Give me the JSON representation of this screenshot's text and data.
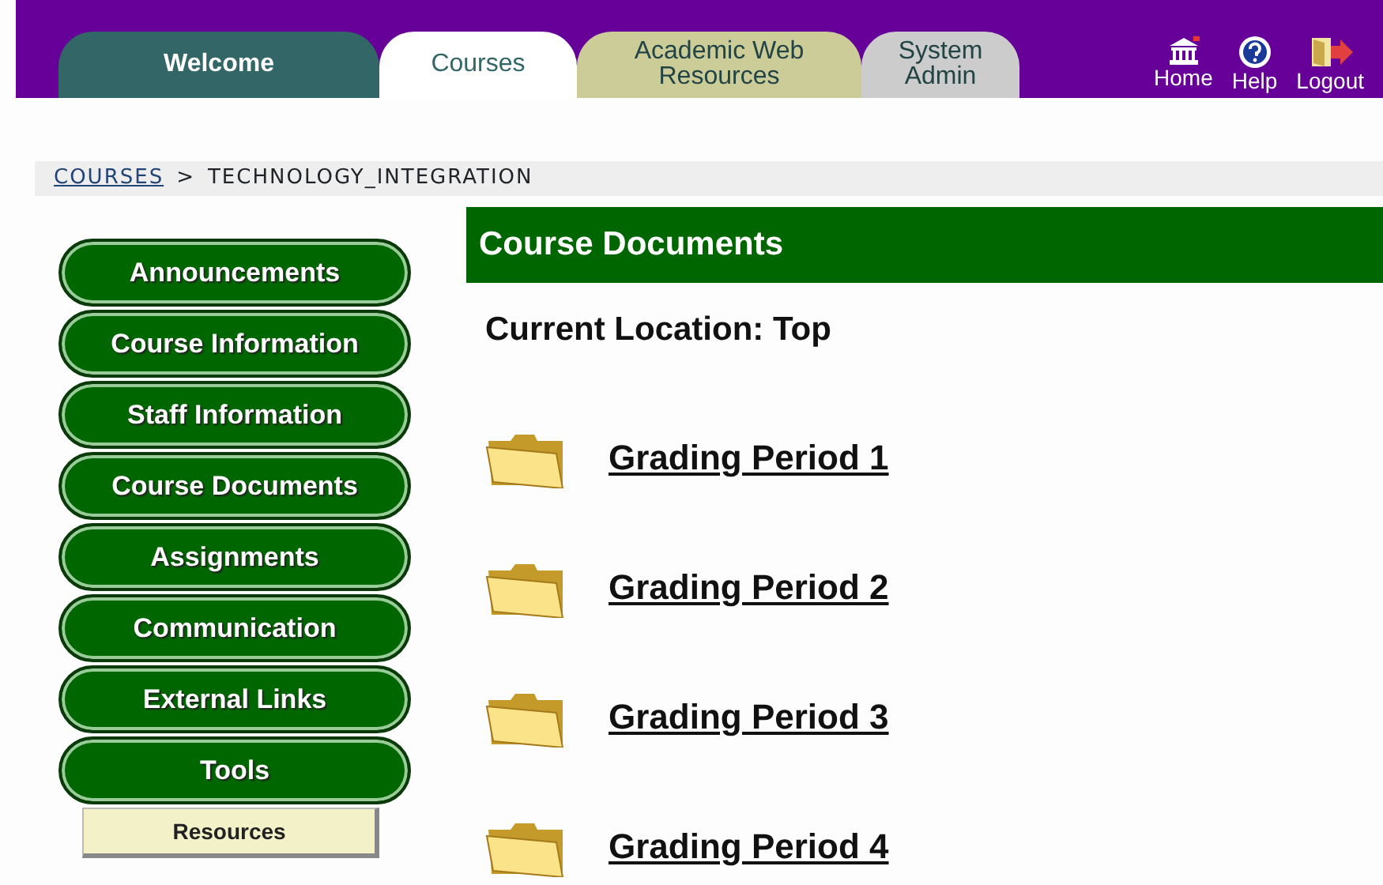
{
  "tabs": [
    {
      "label": "Welcome",
      "selected": false,
      "color": "#336666"
    },
    {
      "label": "Courses",
      "selected": true,
      "color": "#336666"
    },
    {
      "label": "Academic Web Resources",
      "selected": false,
      "color": "#cccc99"
    },
    {
      "label": "System Admin",
      "selected": false,
      "color": "#cccccc"
    }
  ],
  "top_links": [
    {
      "label": "Home",
      "kind": "home"
    },
    {
      "label": "Help",
      "kind": "help"
    },
    {
      "label": "Logout",
      "kind": "logout"
    }
  ],
  "breadcrumb": {
    "link": "COURSES",
    "separator": ">",
    "current": "TECHNOLOGY_INTEGRATION"
  },
  "sidebar": {
    "items": [
      {
        "label": "Announcements",
        "kind": "button"
      },
      {
        "label": "Course Information",
        "kind": "button"
      },
      {
        "label": "Staff Information",
        "kind": "button"
      },
      {
        "label": "Course Documents",
        "kind": "button"
      },
      {
        "label": "Assignments",
        "kind": "button"
      },
      {
        "label": "Communication",
        "kind": "button"
      },
      {
        "label": "External Links",
        "kind": "button"
      },
      {
        "label": "Tools",
        "kind": "button"
      },
      {
        "label": "Resources",
        "kind": "tab"
      }
    ]
  },
  "content": {
    "title": "Course Documents",
    "location": "Current Location: Top",
    "folders": [
      {
        "label": "Grading Period 1"
      },
      {
        "label": "Grading Period 2"
      },
      {
        "label": "Grading Period 3"
      },
      {
        "label": "Grading Period 4"
      }
    ]
  }
}
